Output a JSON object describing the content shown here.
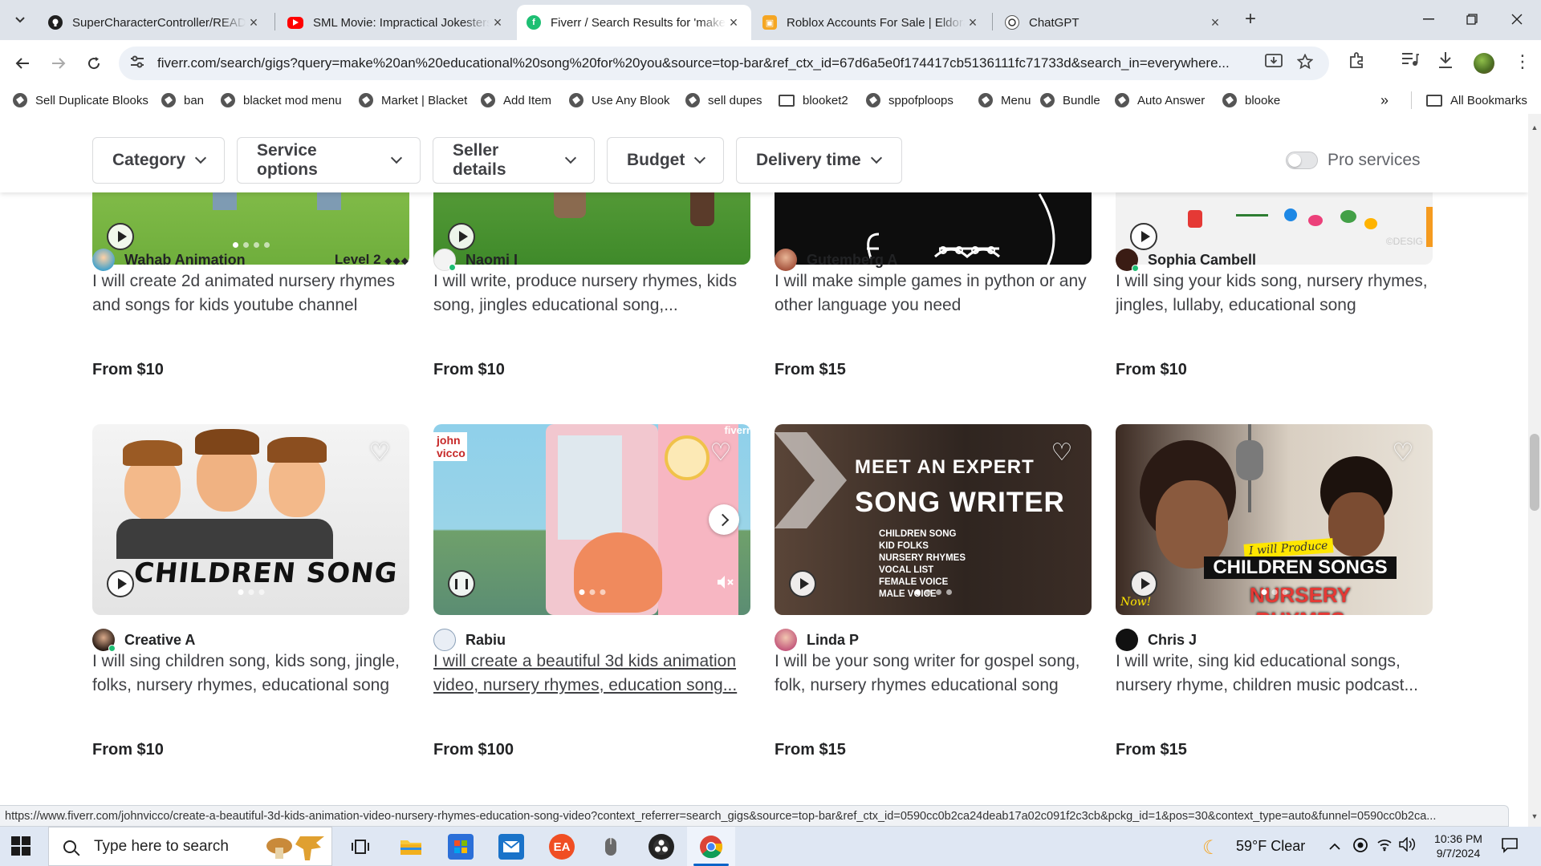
{
  "browser": {
    "tabs": [
      {
        "title": "SuperCharacterController/README",
        "favicon": "github-icon",
        "active": false
      },
      {
        "title": "SML Movie: Impractical Jokesters",
        "favicon": "youtube-icon",
        "active": false
      },
      {
        "title": "Fiverr / Search Results for 'make",
        "favicon": "fiverr-icon",
        "active": true
      },
      {
        "title": "Roblox Accounts For Sale | Eldorado",
        "favicon": "eldorado-icon",
        "active": false
      },
      {
        "title": "ChatGPT",
        "favicon": "chatgpt-icon",
        "active": false
      }
    ],
    "url": "fiverr.com/search/gigs?query=make%20an%20educational%20song%20for%20you&source=top-bar&ref_ctx_id=67d6a5e0f174417cb5136111fc71733d&search_in=everywhere...",
    "bookmarks": [
      {
        "label": "Sell Duplicate Blooks",
        "type": "site"
      },
      {
        "label": "ban",
        "type": "site"
      },
      {
        "label": "blacket mod menu",
        "type": "site"
      },
      {
        "label": "Market | Blacket",
        "type": "site"
      },
      {
        "label": "Add Item",
        "type": "site"
      },
      {
        "label": "Use Any Blook",
        "type": "site"
      },
      {
        "label": "sell dupes",
        "type": "site"
      },
      {
        "label": "blooket2",
        "type": "folder"
      },
      {
        "label": "sppofploops",
        "type": "site"
      },
      {
        "label": "Menu",
        "type": "site"
      },
      {
        "label": "Bundle",
        "type": "site"
      },
      {
        "label": "Auto Answer",
        "type": "site"
      },
      {
        "label": "blooke",
        "type": "site"
      }
    ],
    "all_bookmarks": "All Bookmarks",
    "status_url": "https://www.fiverr.com/johnvicco/create-a-beautiful-3d-kids-animation-video-nursery-rhymes-education-song-video?context_referrer=search_gigs&source=top-bar&ref_ctx_id=0590cc0b2ca24deab17a02c091f2c3cb&pckg_id=1&pos=30&context_type=auto&funnel=0590cc0b2ca..."
  },
  "filters": {
    "buttons": [
      "Category",
      "Service options",
      "Seller details",
      "Budget",
      "Delivery time"
    ],
    "pro_services_label": "Pro services",
    "pro_services_on": false
  },
  "gigs_row1": [
    {
      "seller": "Wahab Animation",
      "level": "Level 2",
      "level_marks": "◆◆◆",
      "title": "I will create 2d animated nursery rhymes and songs for kids youtube channel",
      "price": "From $10"
    },
    {
      "seller": "Naomi I",
      "level": "",
      "title": "I will write, produce nursery rhymes, kids song, jingles educational song,...",
      "price": "From $10"
    },
    {
      "seller": "Gutemberg A",
      "level": "",
      "title": "I will make simple games in python or any other language you need",
      "price": "From $15"
    },
    {
      "seller": "Sophia Cambell",
      "level": "",
      "title": "I will sing your kids song, nursery rhymes, jingles, lullaby, educational song",
      "price": "From $10"
    }
  ],
  "gigs_row2": [
    {
      "seller": "Creative A",
      "title": "I will sing children song, kids song, jingle, folks, nursery rhymes, educational song",
      "price": "From $10",
      "thumb_text": "CHILDREN SONG"
    },
    {
      "seller": "Rabiu",
      "title": "I will create a beautiful 3d kids animation video, nursery rhymes, education song...",
      "price": "From $100",
      "thumb_text": "john vicco",
      "thumb_brand": "fiverr"
    },
    {
      "seller": "Linda P",
      "title": "I will be your song writer for gospel song, folk, nursery rhymes educational song",
      "price": "From $15",
      "thumb_heading_1": "MEET AN EXPERT",
      "thumb_heading_2": "SONG WRITER",
      "thumb_list": [
        "CHILDREN SONG",
        "KID FOLKS",
        "NURSERY RHYMES",
        "VOCAL LIST",
        "FEMALE VOICE",
        "MALE VOICE"
      ]
    },
    {
      "seller": "Chris J",
      "title": "I will write, sing kid educational songs, nursery rhyme, children music podcast...",
      "price": "From $15",
      "thumb_script": "I will Produce",
      "thumb_line1": "CHILDREN SONGS",
      "thumb_line2": "NURSERY RHYMES",
      "thumb_now": "Now!"
    }
  ],
  "row1_thumb_extra": {
    "watermark": "©DESIG"
  },
  "taskbar": {
    "search_placeholder": "Type here to search",
    "weather": "59°F  Clear",
    "time": "10:36 PM",
    "date": "9/7/2024",
    "apps": [
      "task-view-icon",
      "file-explorer-icon",
      "microsoft-store-icon",
      "mail-icon",
      "ea-icon",
      "mouse-app-icon",
      "obs-icon",
      "chrome-icon"
    ]
  },
  "colors": {
    "fiverr_green": "#1dbf73",
    "tab_bar": "#dee3ea",
    "taskbar": "#dfe7f3"
  }
}
